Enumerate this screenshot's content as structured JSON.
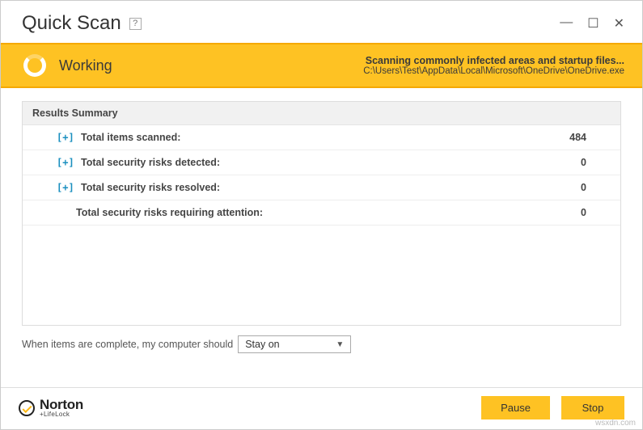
{
  "window": {
    "title": "Quick Scan",
    "help_glyph": "?"
  },
  "status": {
    "label": "Working",
    "line1": "Scanning commonly infected areas and startup files...",
    "line2": "C:\\Users\\Test\\AppData\\Local\\Microsoft\\OneDrive\\OneDrive.exe"
  },
  "summary": {
    "header": "Results Summary",
    "rows": [
      {
        "expand": "[+]",
        "label": "Total items scanned:",
        "value": "484"
      },
      {
        "expand": "[+]",
        "label": "Total security risks detected:",
        "value": "0"
      },
      {
        "expand": "[+]",
        "label": "Total security risks resolved:",
        "value": "0"
      },
      {
        "expand": "",
        "label": "Total security risks requiring attention:",
        "value": "0"
      }
    ]
  },
  "options": {
    "prompt": "When items are complete, my computer should",
    "selected": "Stay on"
  },
  "footer": {
    "logo_main": "Norton",
    "logo_sub": "+LifeLock",
    "pause": "Pause",
    "stop": "Stop"
  },
  "watermark": "wsxdn.com"
}
